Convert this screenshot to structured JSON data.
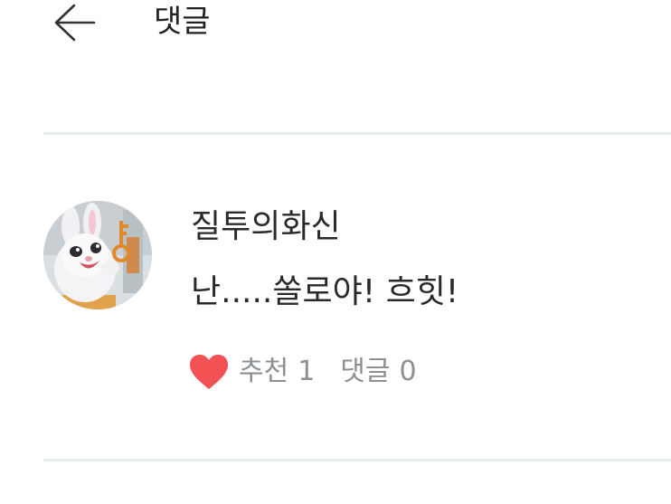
{
  "header": {
    "back_icon": "arrow-left-icon",
    "title": "댓글"
  },
  "comment": {
    "avatar_alt": "white bunny with key",
    "author": "질투의화신",
    "text": "난.....쏠로야! 흐힛!",
    "like": {
      "icon": "heart-icon",
      "color": "#f25254",
      "label": "추천",
      "count": "1"
    },
    "reply": {
      "label": "댓글",
      "count": "0"
    }
  },
  "colors": {
    "divider": "#e6ece8",
    "muted_text": "#8b9094",
    "heart": "#f25254"
  }
}
